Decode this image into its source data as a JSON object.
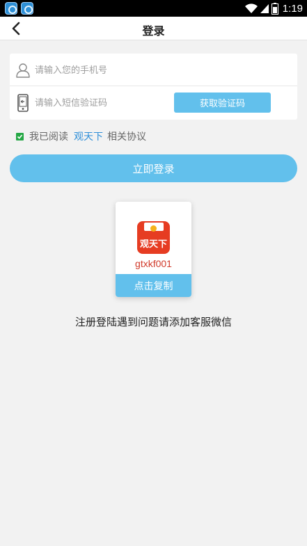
{
  "status_bar": {
    "time": "1:19",
    "icons": [
      "app-icon-1",
      "app-icon-2",
      "wifi-icon",
      "signal-icon",
      "battery-icon"
    ]
  },
  "nav": {
    "title": "登录",
    "back_icon": "chevron-left-icon"
  },
  "form": {
    "phone_placeholder": "请输入您的手机号",
    "phone_icon": "user-icon",
    "code_placeholder": "请输入短信验证码",
    "code_icon": "phone-icon",
    "get_code_label": "获取验证码"
  },
  "agreement": {
    "prefix": "我已阅读",
    "link": "观天下",
    "suffix": "相关协议",
    "checked": true
  },
  "login_label": "立即登录",
  "wechat_card": {
    "logo_text": "观天下",
    "wechat_id": "gtxkf001",
    "copy_label": "点击复制"
  },
  "help_text": "注册登陆遇到问题请添加客服微信",
  "colors": {
    "accent": "#62c0ec",
    "link": "#2f8fd8",
    "check": "#26a846",
    "logo_red": "#e63c22",
    "id_red": "#d13a2a"
  }
}
